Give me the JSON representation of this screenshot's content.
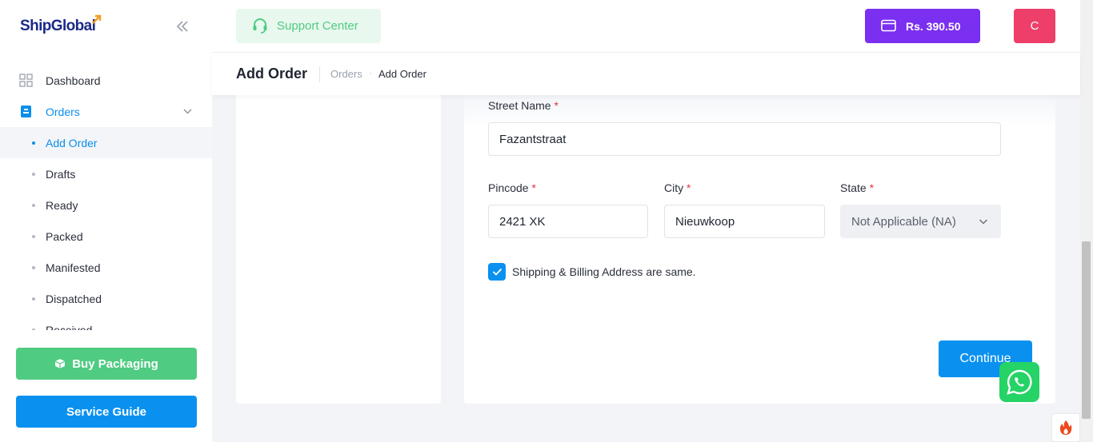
{
  "app": {
    "logo": "ShipGlobal"
  },
  "sidebar": {
    "items": [
      {
        "label": "Dashboard",
        "icon": "grid-icon"
      },
      {
        "label": "Orders",
        "icon": "clipboard-icon",
        "active": true,
        "expanded": true
      }
    ],
    "sub_items": [
      {
        "label": "Add Order",
        "current": true
      },
      {
        "label": "Drafts"
      },
      {
        "label": "Ready"
      },
      {
        "label": "Packed"
      },
      {
        "label": "Manifested"
      },
      {
        "label": "Dispatched"
      },
      {
        "label": "Received"
      }
    ],
    "buy_packaging_label": "Buy Packaging",
    "service_guide_label": "Service Guide"
  },
  "header": {
    "support_label": "Support Center",
    "wallet_balance": "Rs. 390.50",
    "avatar_initial": "C"
  },
  "page": {
    "title": "Add Order",
    "breadcrumb": [
      "Orders",
      "Add Order"
    ]
  },
  "form": {
    "street_name": {
      "label": "Street Name",
      "required": "*",
      "value": "Fazantstraat"
    },
    "pincode": {
      "label": "Pincode",
      "required": "*",
      "value": "2421 XK"
    },
    "city": {
      "label": "City",
      "required": "*",
      "value": "Nieuwkoop"
    },
    "state": {
      "label": "State",
      "required": "*",
      "value": "Not Applicable (NA)"
    },
    "same_address": {
      "label": "Shipping & Billing Address are same.",
      "checked": true
    },
    "continue_label": "Continue"
  },
  "colors": {
    "accent": "#0a91f0",
    "green": "#4fcb82",
    "purple": "#7b2ff0",
    "pink": "#ee3e6a",
    "whatsapp": "#25d366"
  }
}
